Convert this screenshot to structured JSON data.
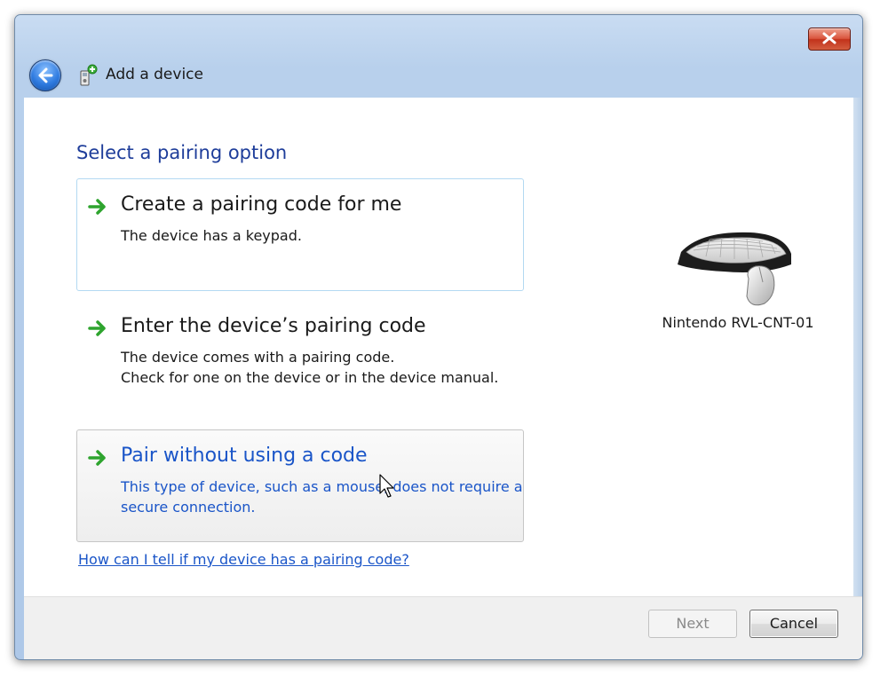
{
  "window": {
    "title": "Add a device"
  },
  "page": {
    "heading": "Select a pairing option"
  },
  "options": [
    {
      "title": "Create a pairing code for me",
      "description": [
        "The device has a keypad."
      ]
    },
    {
      "title": "Enter the device’s pairing code",
      "description": [
        "The device comes with a pairing code.",
        "Check for one on the device or in the device manual."
      ]
    },
    {
      "title": "Pair without using a code",
      "description": [
        "This type of device, such as a mouse, does not require a",
        "secure connection."
      ]
    }
  ],
  "help_link": "How can I tell if my device has a pairing code?",
  "device": {
    "name": "Nintendo RVL-CNT-01",
    "icon": "keyboard-mouse-icon"
  },
  "footer": {
    "next_label": "Next",
    "cancel_label": "Cancel"
  },
  "colors": {
    "heading": "#1e3d9a",
    "link": "#1a55c8",
    "arrow": "#2ea42e",
    "close": "#c2321b"
  }
}
